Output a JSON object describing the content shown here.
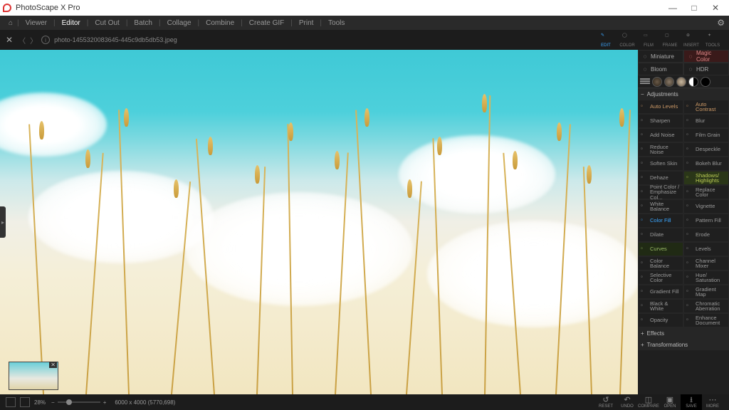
{
  "app": {
    "title": "PhotoScape X Pro"
  },
  "win": {
    "min": "—",
    "max": "□",
    "close": "✕"
  },
  "menu": {
    "items": [
      "Viewer",
      "Editor",
      "Cut Out",
      "Batch",
      "Collage",
      "Combine",
      "Create GIF",
      "Print",
      "Tools"
    ],
    "active": "Editor"
  },
  "toolbar": {
    "filename": "photo-1455320083645-445c9db5db53.jpeg",
    "tools": [
      {
        "id": "edit",
        "label": "EDIT"
      },
      {
        "id": "color",
        "label": "COLOR"
      },
      {
        "id": "film",
        "label": "FILM"
      },
      {
        "id": "frame",
        "label": "FRAME"
      },
      {
        "id": "insert",
        "label": "INSERT"
      },
      {
        "id": "tools",
        "label": "TOOLS"
      }
    ],
    "active": "edit"
  },
  "rpanel": {
    "top": [
      {
        "id": "miniature",
        "label": "Miniature"
      },
      {
        "id": "magic",
        "label": "Magic Color",
        "cls": "magic"
      },
      {
        "id": "bloom",
        "label": "Bloom"
      },
      {
        "id": "hdr",
        "label": "HDR"
      }
    ],
    "section_adjust": "Adjustments",
    "adjust": [
      {
        "l": "Auto Levels",
        "cls": "hglt-auto"
      },
      {
        "l": "Auto Contrast",
        "cls": "hglt-auto"
      },
      {
        "l": "Sharpen"
      },
      {
        "l": "Blur"
      },
      {
        "l": "Add Noise"
      },
      {
        "l": "Film Grain"
      },
      {
        "l": "Reduce Noise"
      },
      {
        "l": "Despeckle"
      },
      {
        "l": "Soften Skin"
      },
      {
        "l": "Bokeh Blur"
      },
      {
        "l": "Dehaze"
      },
      {
        "l": "Shadows/ Highlights",
        "cls": "hglt-green"
      },
      {
        "l": "Point Color / Emphasize Col..."
      },
      {
        "l": "Replace Color"
      },
      {
        "l": "White Balance"
      },
      {
        "l": "Vignette"
      },
      {
        "l": "Color Fill",
        "cls": "hglt-blue"
      },
      {
        "l": "Pattern Fill"
      },
      {
        "l": "Dilate"
      },
      {
        "l": "Erode"
      },
      {
        "l": "Curves",
        "cls": "hglt-dkgreen"
      },
      {
        "l": "Levels"
      },
      {
        "l": "Color Balance"
      },
      {
        "l": "Channel Mixer"
      },
      {
        "l": "Selective Color"
      },
      {
        "l": "Hue/ Saturation"
      },
      {
        "l": "Gradient Fill"
      },
      {
        "l": "Gradient Map"
      },
      {
        "l": "Black & White"
      },
      {
        "l": "Chromatic Aberration"
      },
      {
        "l": "Opacity"
      },
      {
        "l": "Enhance Document"
      }
    ],
    "section_effects": "Effects",
    "section_transform": "Transformations"
  },
  "status": {
    "zoom": "28%",
    "dims": "6000 x 4000  (5770,698)",
    "minus": "−",
    "plus": "+",
    "buttons": [
      {
        "id": "reset",
        "label": "RESET",
        "icon": "↺"
      },
      {
        "id": "undo",
        "label": "UNDO",
        "icon": "↶"
      },
      {
        "id": "compare",
        "label": "COMPARE",
        "icon": "◫"
      },
      {
        "id": "open",
        "label": "OPEN",
        "icon": "▣"
      },
      {
        "id": "save",
        "label": "SAVE",
        "icon": "⭳",
        "primary": true
      },
      {
        "id": "more",
        "label": "MORE",
        "icon": "⋯"
      }
    ]
  }
}
